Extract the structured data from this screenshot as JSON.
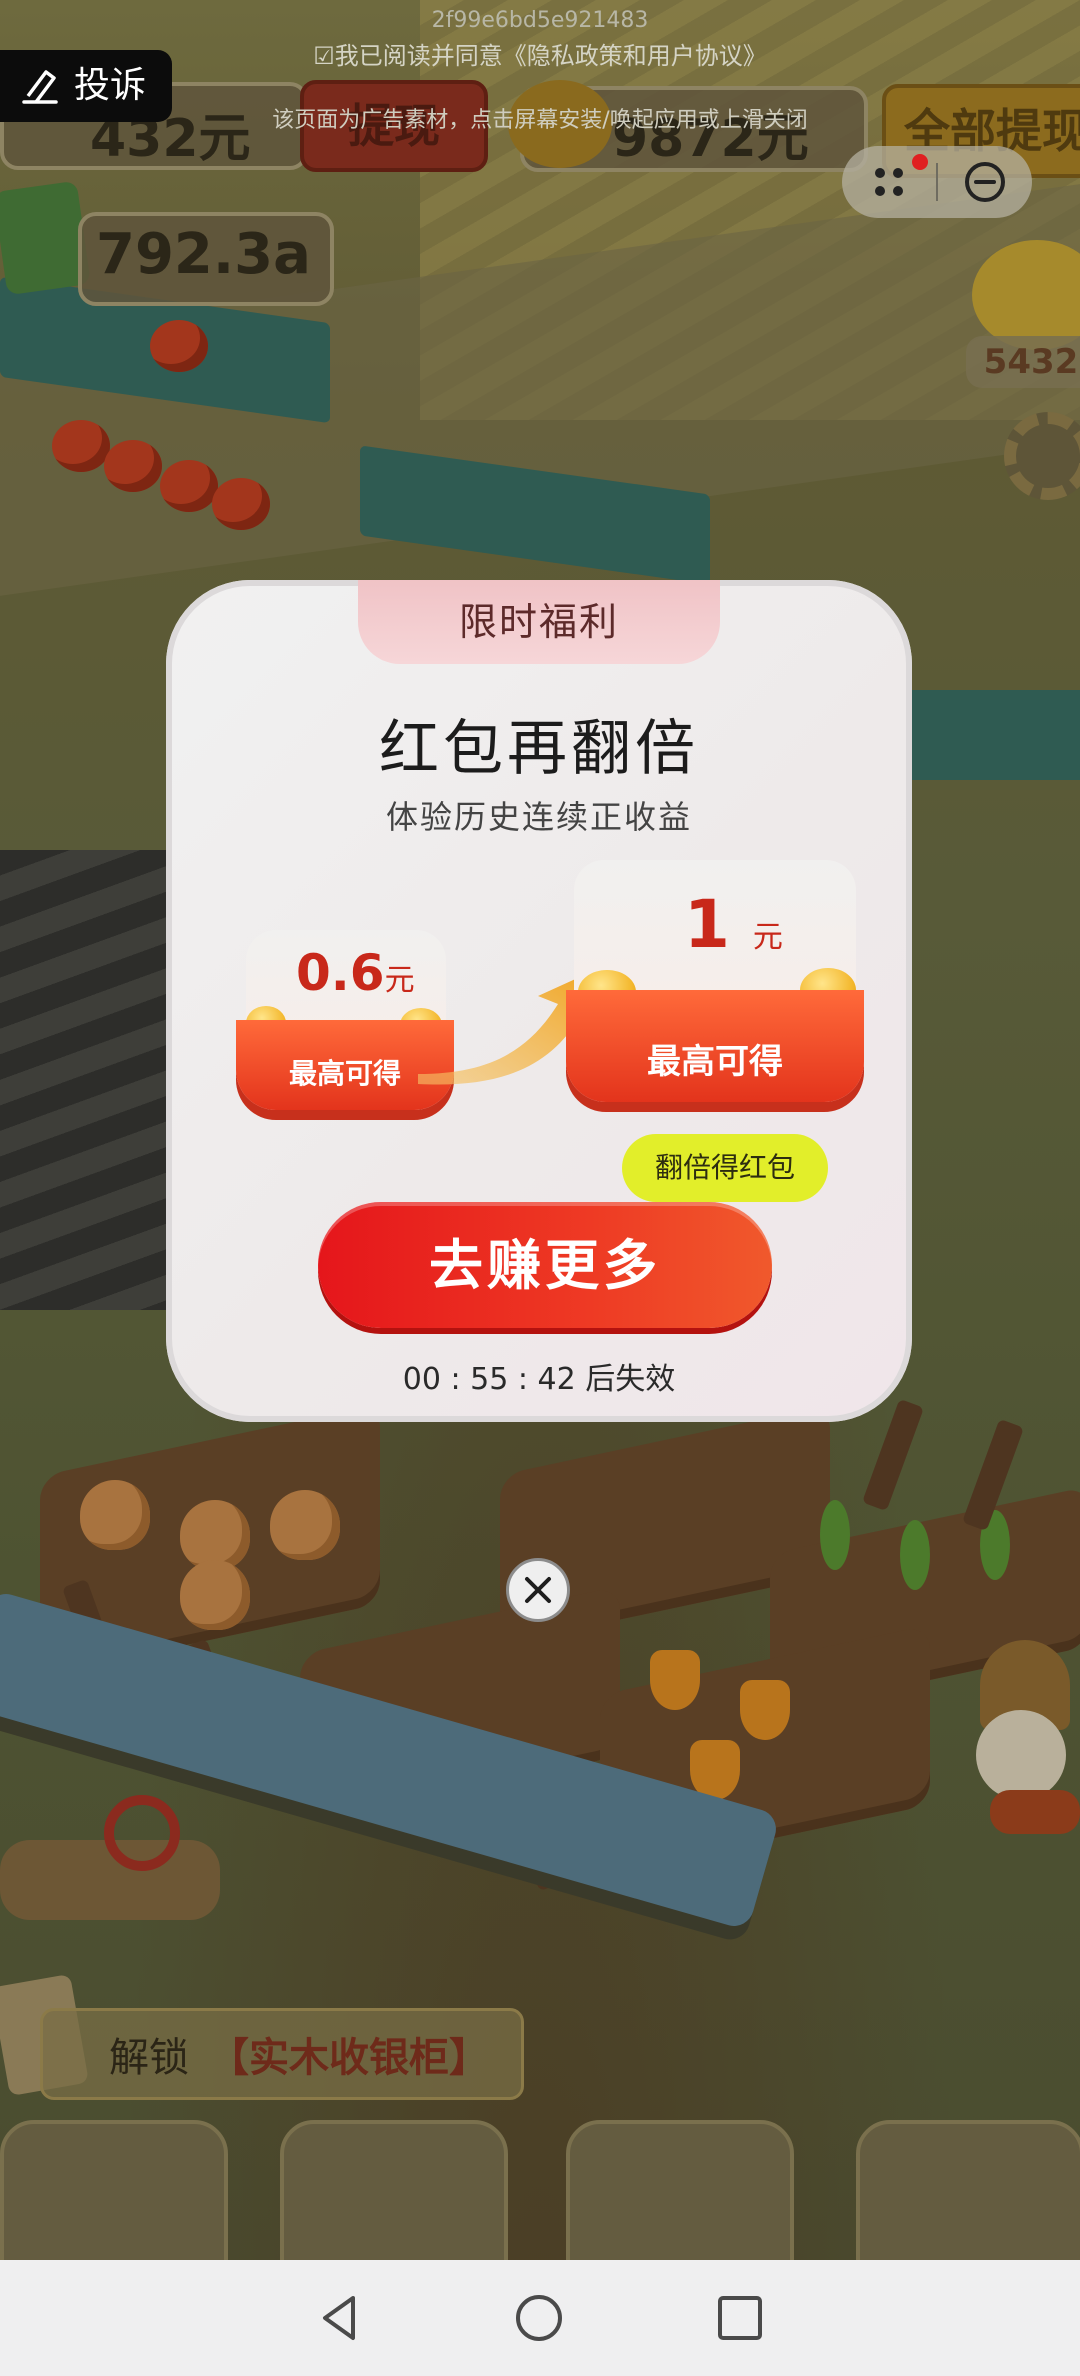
{
  "overlay": {
    "ad_id": "2f99e6bd5e921483",
    "agreement": "☑我已阅读并同意《隐私政策和用户协议》",
    "tip": "该页面为广告素材，点击屏幕安装/唤起应用或上滑关闭"
  },
  "complain": {
    "label": "投诉"
  },
  "hud": {
    "money_value": "432元",
    "withdraw_label": "提现",
    "gold_value": "9872元",
    "withdraw_all_label": "全部提现",
    "cash_value": "792.3a",
    "smile_count": "5432"
  },
  "modal": {
    "tab_label": "限时福利",
    "title": "红包再翻倍",
    "subtitle": "体验历史连续正收益",
    "left_amount": "0.6",
    "left_unit": "元",
    "left_label": "最高可得",
    "right_amount": "1",
    "right_unit": "元",
    "right_label": "最高可得",
    "bubble": "翻倍得红包",
    "cta": "去赚更多",
    "timer": "00 : 55 : 42 后失效"
  },
  "bottom": {
    "unlock_prefix": "解锁",
    "unlock_item": "【实木收银柜】"
  },
  "icons": [
    "complain-icon",
    "menu-dots-icon",
    "minimize-icon",
    "close-icon",
    "back-icon",
    "home-icon",
    "recents-icon",
    "settings-gear-icon"
  ],
  "colors": {
    "accent_red": "#e5161b",
    "bubble_yellow": "#e2ee2a",
    "tab_pink": "#f0c3c6"
  }
}
